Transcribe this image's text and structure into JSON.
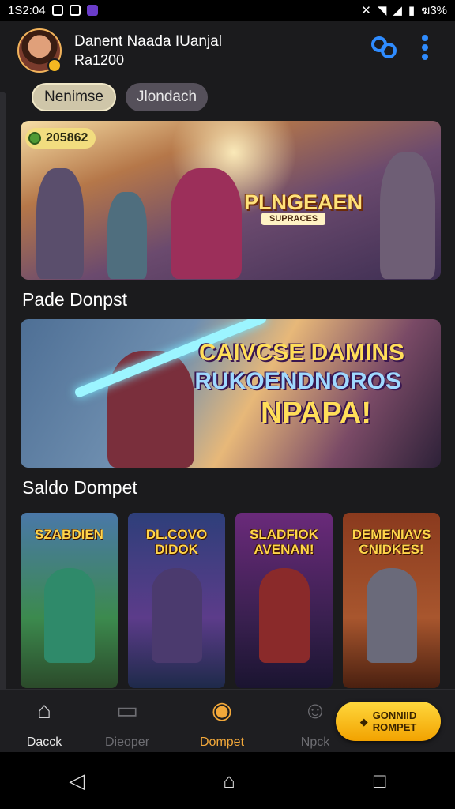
{
  "status_bar": {
    "time": "1S2:04",
    "battery": "ฆ3%"
  },
  "header": {
    "user_name": "Danent Naada IUanjal",
    "balance": "Ra1200",
    "link_icon": "link-icon",
    "menu_icon": "more-vertical-icon"
  },
  "chips": [
    {
      "label": "Nenimse"
    },
    {
      "label": "Jlondach"
    }
  ],
  "hero": {
    "coin_value": "205862",
    "title": "PLNGEAEN",
    "subtitle": "SUPRACES"
  },
  "sections": {
    "first": "Pade Donpst",
    "second": "Saldo Dompet"
  },
  "promo": {
    "line1": "CAIVCSE DAMINS",
    "line2": "RUKOENDNOROS",
    "line3": "NPAPA!"
  },
  "cards": [
    {
      "title": "SZABDIEN"
    },
    {
      "title": "DL.COVO DIDOK"
    },
    {
      "title": "SLADFIOK AVENAN!"
    },
    {
      "title": "DEMENIAVS CNIDKES!"
    }
  ],
  "bottom_nav": [
    {
      "label": "Dacck",
      "icon": "home-icon"
    },
    {
      "label": "Dieoper",
      "icon": "ticket-icon"
    },
    {
      "label": "Dompet",
      "icon": "coin-icon"
    },
    {
      "label": "Npck",
      "icon": "user-icon"
    }
  ],
  "cta": {
    "line1": "GONNIID",
    "line2": "ROMPET"
  },
  "colors": {
    "accent": "#f2a83a",
    "link_blue": "#2f8cff",
    "background": "#1b1b1d"
  }
}
